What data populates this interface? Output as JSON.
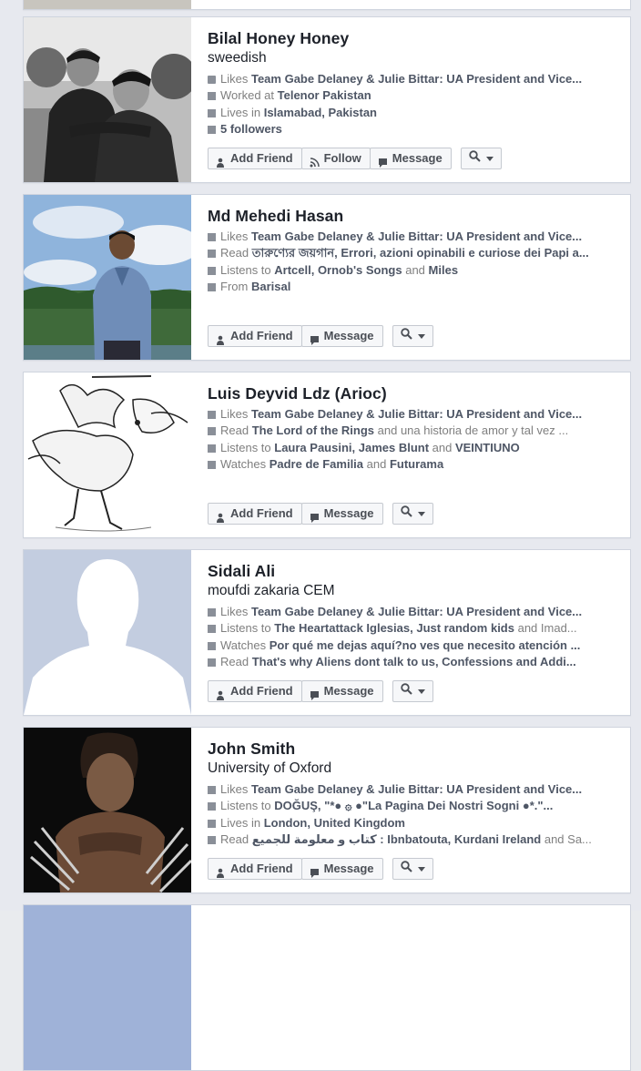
{
  "results": [
    {
      "name": "Bilal Honey Honey",
      "subtitle": "sweedish",
      "lines": [
        {
          "icon": "like-icon",
          "prefix": "Likes ",
          "bold": "Team Gabe Delaney & Julie Bittar: UA President and Vice...",
          "rest": ""
        },
        {
          "icon": "briefcase-icon",
          "prefix": "Worked at ",
          "bold": "Telenor Pakistan",
          "rest": ""
        },
        {
          "icon": "home-icon",
          "prefix": "Lives in ",
          "bold": "Islamabad, Pakistan",
          "rest": ""
        },
        {
          "icon": "followers-icon",
          "prefix": "",
          "bold": "5 followers",
          "rest": ""
        }
      ],
      "buttons": [
        "Add Friend",
        "Follow",
        "Message"
      ]
    },
    {
      "name": "Md Mehedi Hasan",
      "subtitle": "",
      "lines": [
        {
          "icon": "like-icon",
          "prefix": "Likes ",
          "bold": "Team Gabe Delaney & Julie Bittar: UA President and Vice...",
          "rest": ""
        },
        {
          "icon": "book-icon",
          "prefix": "Read ",
          "bold": "তারুণ্যের জয়গান, Errori, azioni opinabili e curiose dei Papi a...",
          "rest": ""
        },
        {
          "icon": "music-icon",
          "prefix": "Listens to ",
          "bold": "Artcell, Ornob's Songs",
          "rest": " and ",
          "bold2": "Miles"
        },
        {
          "icon": "location-icon",
          "prefix": "From ",
          "bold": "Barisal",
          "rest": ""
        }
      ],
      "buttons": [
        "Add Friend",
        "Message"
      ]
    },
    {
      "name": "Luis Deyvid Ldz (Arioc)",
      "subtitle": "",
      "lines": [
        {
          "icon": "like-icon",
          "prefix": "Likes ",
          "bold": "Team Gabe Delaney & Julie Bittar: UA President and Vice...",
          "rest": ""
        },
        {
          "icon": "book-icon",
          "prefix": "Read ",
          "bold": "The Lord of the Rings",
          "rest": " and una historia de amor y tal vez ..."
        },
        {
          "icon": "music-icon",
          "prefix": "Listens to ",
          "bold": "Laura Pausini, James Blunt",
          "rest": " and ",
          "bold2": "VEINTIUNO"
        },
        {
          "icon": "tv-icon",
          "prefix": "Watches ",
          "bold": "Padre de Familia",
          "rest": " and ",
          "bold2": "Futurama"
        }
      ],
      "buttons": [
        "Add Friend",
        "Message"
      ]
    },
    {
      "name": "Sidali Ali",
      "subtitle": "moufdi zakaria CEM",
      "lines": [
        {
          "icon": "like-icon",
          "prefix": "Likes ",
          "bold": "Team Gabe Delaney & Julie Bittar: UA President and Vice...",
          "rest": ""
        },
        {
          "icon": "music-icon",
          "prefix": "Listens to ",
          "bold": "The Heartattack Iglesias, Just random kids",
          "rest": " and Imad..."
        },
        {
          "icon": "tv-icon",
          "prefix": "Watches ",
          "bold": "Por qué me dejas aquí?no ves que necesito atención ...",
          "rest": ""
        },
        {
          "icon": "book-icon",
          "prefix": "Read ",
          "bold": "That's why Aliens dont talk to us, Confessions and Addi...",
          "rest": ""
        }
      ],
      "buttons": [
        "Add Friend",
        "Message"
      ]
    },
    {
      "name": "John Smith",
      "subtitle": "University of Oxford",
      "lines": [
        {
          "icon": "like-icon",
          "prefix": "Likes ",
          "bold": "Team Gabe Delaney & Julie Bittar: UA President and Vice...",
          "rest": ""
        },
        {
          "icon": "music-icon",
          "prefix": "Listens to ",
          "bold": "DOĞUŞ, \"*● ۞ ●\"La Pagina Dei Nostri Sogni ●*.\"...",
          "rest": ""
        },
        {
          "icon": "home-icon",
          "prefix": "Lives in ",
          "bold": "London, United Kingdom",
          "rest": ""
        },
        {
          "icon": "book-icon",
          "prefix": "Read ",
          "bold": "كتاب و معلومة للجميع : Ibnbatouta, Kurdani Ireland",
          "rest": " and Sa..."
        }
      ],
      "buttons": [
        "Add Friend",
        "Message"
      ]
    }
  ],
  "colors": {
    "page": "#e9ebee",
    "link": "#4e5665",
    "meta": "#7f7f7f",
    "name": "#1d2129"
  }
}
